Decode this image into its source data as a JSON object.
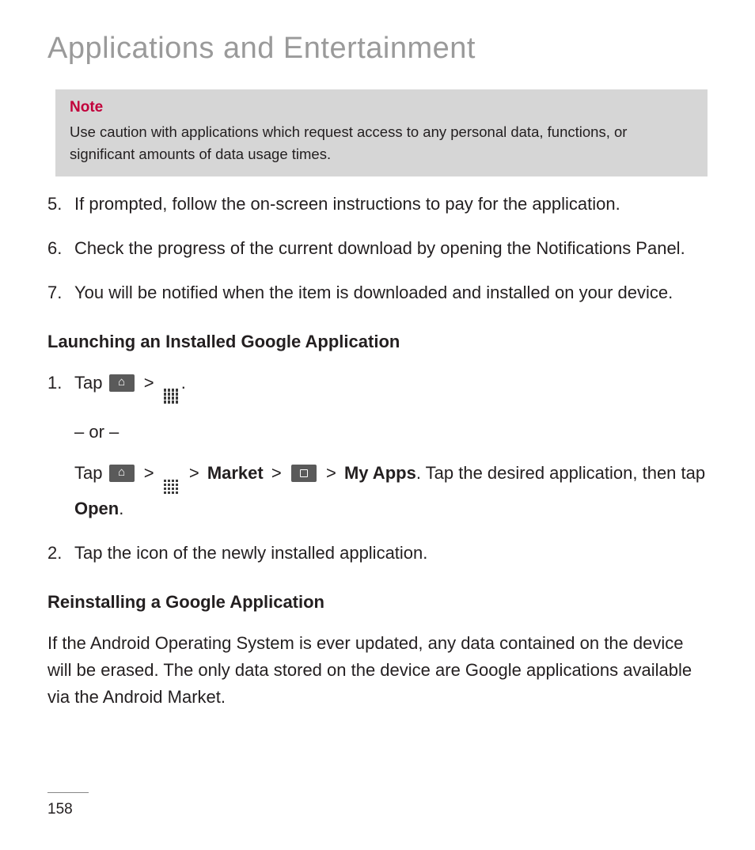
{
  "title": "Applications and Entertainment",
  "note": {
    "heading": "Note",
    "body": "Use caution with applications which request access to any personal data, functions, or significant amounts of data usage times."
  },
  "steps_cont": {
    "s5": "If prompted, follow the on-screen instructions to pay for the application.",
    "s6": "Check the progress of the current download by opening the Notifications Panel.",
    "s7": "You will be notified when the item is downloaded and installed on your device."
  },
  "launching": {
    "heading": "Launching an Installed Google Application",
    "step1_lead": "Tap ",
    "or": "– or –",
    "alt_lead": "Tap ",
    "market": "Market",
    "myapps": "My Apps",
    "alt_tail": ". Tap the desired application, then tap ",
    "open": "Open",
    "period": ".",
    "step2": "Tap the icon of the newly installed application."
  },
  "reinstalling": {
    "heading": "Reinstalling a Google Application",
    "para": "If the Android Operating System is ever updated, any data contained on the device will be erased. The only data stored on the device are Google applications available via the Android Market."
  },
  "page_number": "158",
  "separators": {
    "gt": ">"
  }
}
